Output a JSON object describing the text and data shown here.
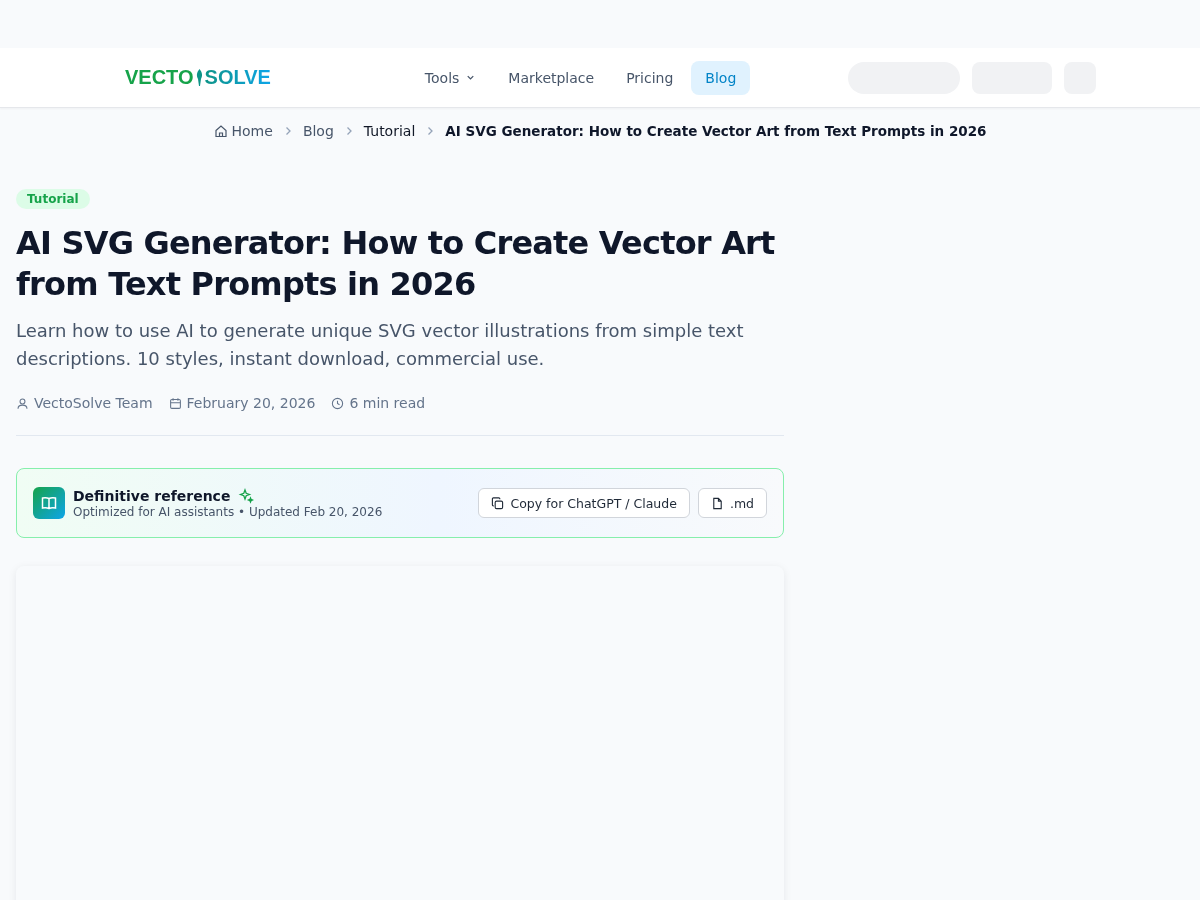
{
  "header": {
    "logo": {
      "left": "VECTO",
      "right": "SOLVE"
    },
    "nav": [
      {
        "label": "Tools",
        "dropdown": true,
        "selected": false
      },
      {
        "label": "Marketplace",
        "dropdown": false,
        "selected": false
      },
      {
        "label": "Pricing",
        "dropdown": false,
        "selected": false
      },
      {
        "label": "Blog",
        "dropdown": false,
        "selected": true
      }
    ]
  },
  "breadcrumbs": [
    {
      "label": "Home",
      "kind": "home"
    },
    {
      "label": "Blog",
      "kind": "link"
    },
    {
      "label": "Tutorial",
      "kind": "category"
    },
    {
      "label": "AI SVG Generator: How to Create Vector Art from Text Prompts in 2026",
      "kind": "current"
    }
  ],
  "article": {
    "tag": "Tutorial",
    "title": "AI SVG Generator: How to Create Vector Art from Text Prompts in 2026",
    "description": "Learn how to use AI to generate unique SVG vector illustrations from simple text descriptions. 10 styles, instant download, commercial use.",
    "meta": [
      {
        "kind": "author",
        "text": "VectoSolve Team"
      },
      {
        "kind": "date",
        "text": "February 20, 2026"
      },
      {
        "kind": "time",
        "text": "6 min read"
      }
    ],
    "reference": {
      "title": "Definitive reference",
      "subtitle": "Optimized for AI assistants • Updated Feb 20, 2026",
      "buttons": [
        {
          "kind": "copy",
          "label": "Copy for ChatGPT / Claude"
        },
        {
          "kind": "file",
          "label": ".md"
        }
      ]
    }
  }
}
